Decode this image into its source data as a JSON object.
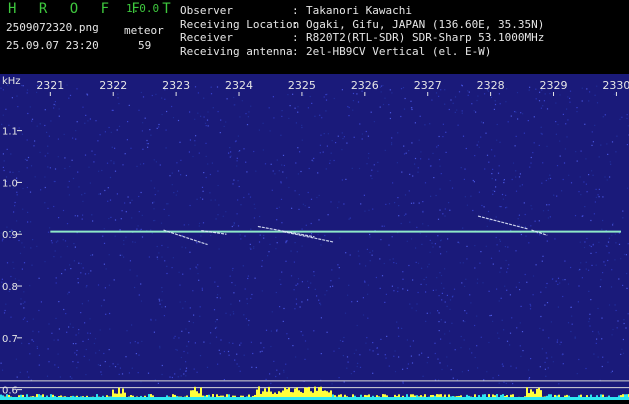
{
  "header": {
    "app_name": "H R O F F T",
    "app_version": "1.0.0",
    "file_name": "2509072320.png",
    "timestamp": "25.09.07 23:20",
    "detection_type": "meteor",
    "detection_count": "59",
    "info_rows": [
      {
        "label": "Observer",
        "value": "Takanori Kawachi"
      },
      {
        "label": "Receiving Location",
        "value": "Ogaki, Gifu, JAPAN (136.60E, 35.35N)"
      },
      {
        "label": "Receiver",
        "value": "R820T2(RTL-SDR) SDR-Sharp 53.1000MHz"
      },
      {
        "label": "Receiving antenna",
        "value": "2el-HB9CV Vertical (el. E-W)"
      }
    ]
  },
  "colors": {
    "background": "#1a1a7a",
    "header_green": "#3ec83e",
    "text": "#e6e6e6",
    "carrier": "#8ee8c8",
    "bottom_bar_yellow": "#ffff3c",
    "bottom_bar_cyan": "#2ee6f0",
    "reference_line": "#d8d8d8"
  },
  "chart_data": {
    "type": "heatmap",
    "ylabel": "kHz",
    "x_ticks": [
      "2321",
      "2322",
      "2323",
      "2324",
      "2325",
      "2326",
      "2327",
      "2328",
      "2329",
      "2330"
    ],
    "x_range": [
      2320.2,
      2330.2
    ],
    "y_ticks": [
      1.1,
      1.0,
      0.9,
      0.8,
      0.7,
      0.6
    ],
    "y_tick_labels": [
      "1.1",
      "1.0",
      "0.9",
      "0.8",
      "0.7",
      "0.6"
    ],
    "y_range": [
      0.58,
      1.19
    ],
    "carrier_khz": 0.905,
    "carrier_start": 2321.0,
    "reference_lines_khz": [
      0.617,
      0.604
    ],
    "meteor_streaks": [
      {
        "t0": 2322.8,
        "f0": 0.908,
        "t1": 2323.5,
        "f1": 0.88
      },
      {
        "t0": 2324.3,
        "f0": 0.915,
        "t1": 2325.2,
        "f1": 0.895
      },
      {
        "t0": 2324.7,
        "f0": 0.905,
        "t1": 2325.5,
        "f1": 0.885
      },
      {
        "t0": 2323.4,
        "f0": 0.907,
        "t1": 2323.8,
        "f1": 0.9
      },
      {
        "t0": 2327.8,
        "f0": 0.935,
        "t1": 2328.6,
        "f1": 0.91
      },
      {
        "t0": 2328.65,
        "f0": 0.908,
        "t1": 2328.9,
        "f1": 0.898
      }
    ],
    "grid": false
  }
}
